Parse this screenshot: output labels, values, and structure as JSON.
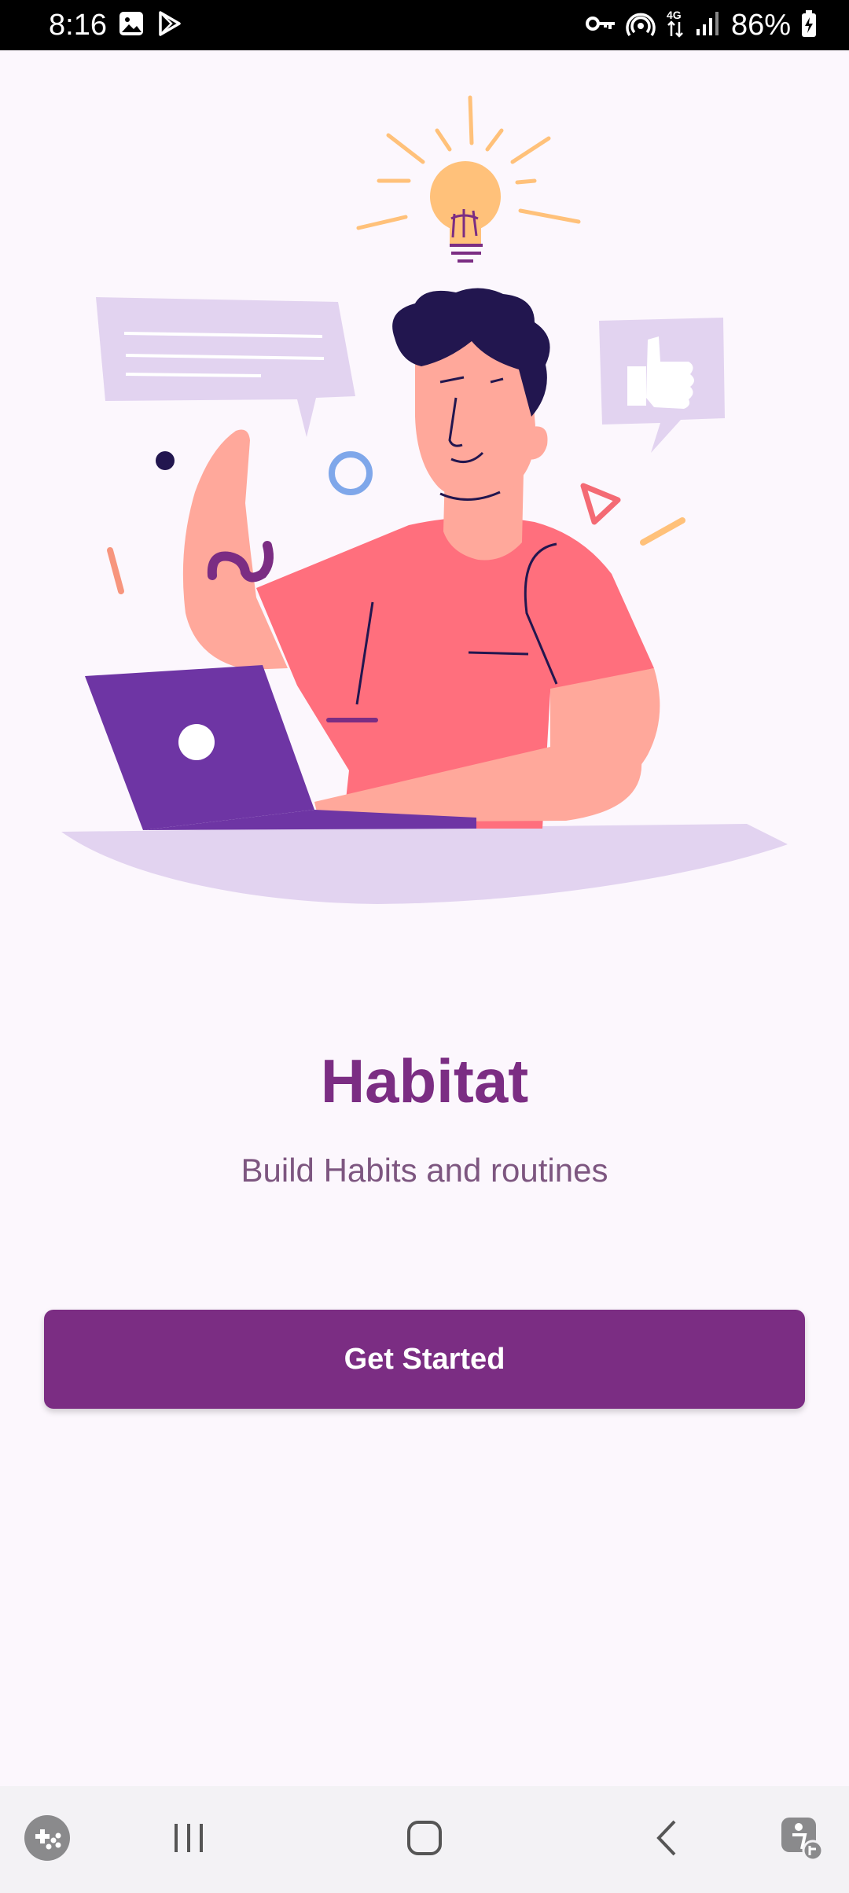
{
  "status_bar": {
    "time": "8:16",
    "battery_text": "86%",
    "left_icons": [
      "gallery-icon",
      "play-store-icon"
    ],
    "right_icons": [
      "vpn-key-icon",
      "hotspot-icon",
      "network-4g-icon",
      "signal-icon",
      "battery-charging-icon"
    ]
  },
  "hero": {
    "illustration": "person-at-laptop-with-lightbulb-illustration"
  },
  "app": {
    "title": "Habitat",
    "subtitle": "Build Habits and routines"
  },
  "cta": {
    "label": "Get Started"
  },
  "nav_bar": {
    "items": [
      "game-launcher-icon",
      "recent-apps-icon",
      "home-icon",
      "back-icon",
      "accessibility-icon"
    ]
  },
  "colors": {
    "primary": "#7b2d83",
    "background": "#fcf7fd",
    "subtitle": "#7d5680"
  }
}
